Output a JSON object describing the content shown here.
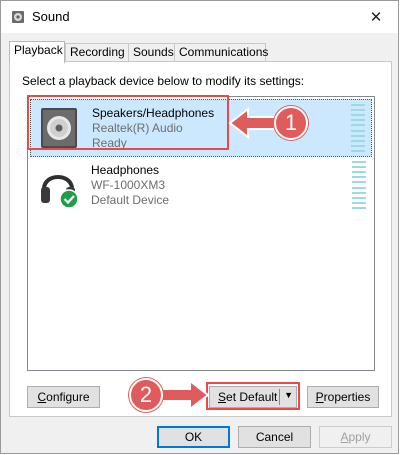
{
  "window": {
    "title": "Sound",
    "close_symbol": "✕"
  },
  "tabs": [
    {
      "label": "Playback",
      "active": true
    },
    {
      "label": "Recording",
      "active": false
    },
    {
      "label": "Sounds",
      "active": false
    },
    {
      "label": "Communications",
      "active": false
    }
  ],
  "instruction": "Select a playback device below to modify its settings:",
  "devices": [
    {
      "name": "Speakers/Headphones",
      "driver": "Realtek(R) Audio",
      "status": "Ready",
      "icon": "speaker-icon",
      "selected": true
    },
    {
      "name": "Headphones",
      "driver": "WF-1000XM3",
      "status": "Default Device",
      "icon": "headphones-icon",
      "selected": false
    }
  ],
  "buttons": {
    "configure": {
      "label": "Configure",
      "mnemonic": "C",
      "rest": "onfigure"
    },
    "set_default": {
      "label": "Set Default",
      "mnemonic": "S",
      "rest": "et Default",
      "arrow": "▼"
    },
    "properties": {
      "label": "Properties",
      "mnemonic": "P",
      "rest": "roperties"
    },
    "ok": {
      "label": "OK"
    },
    "cancel": {
      "label": "Cancel"
    },
    "apply": {
      "label": "Apply",
      "mnemonic": "A",
      "rest": "pply",
      "disabled": true
    }
  },
  "annotations": {
    "callout_1": "1",
    "callout_2": "2"
  },
  "colors": {
    "accent": "#e05b5b",
    "selection": "#cce8ff",
    "check": "#1e9e4a"
  }
}
